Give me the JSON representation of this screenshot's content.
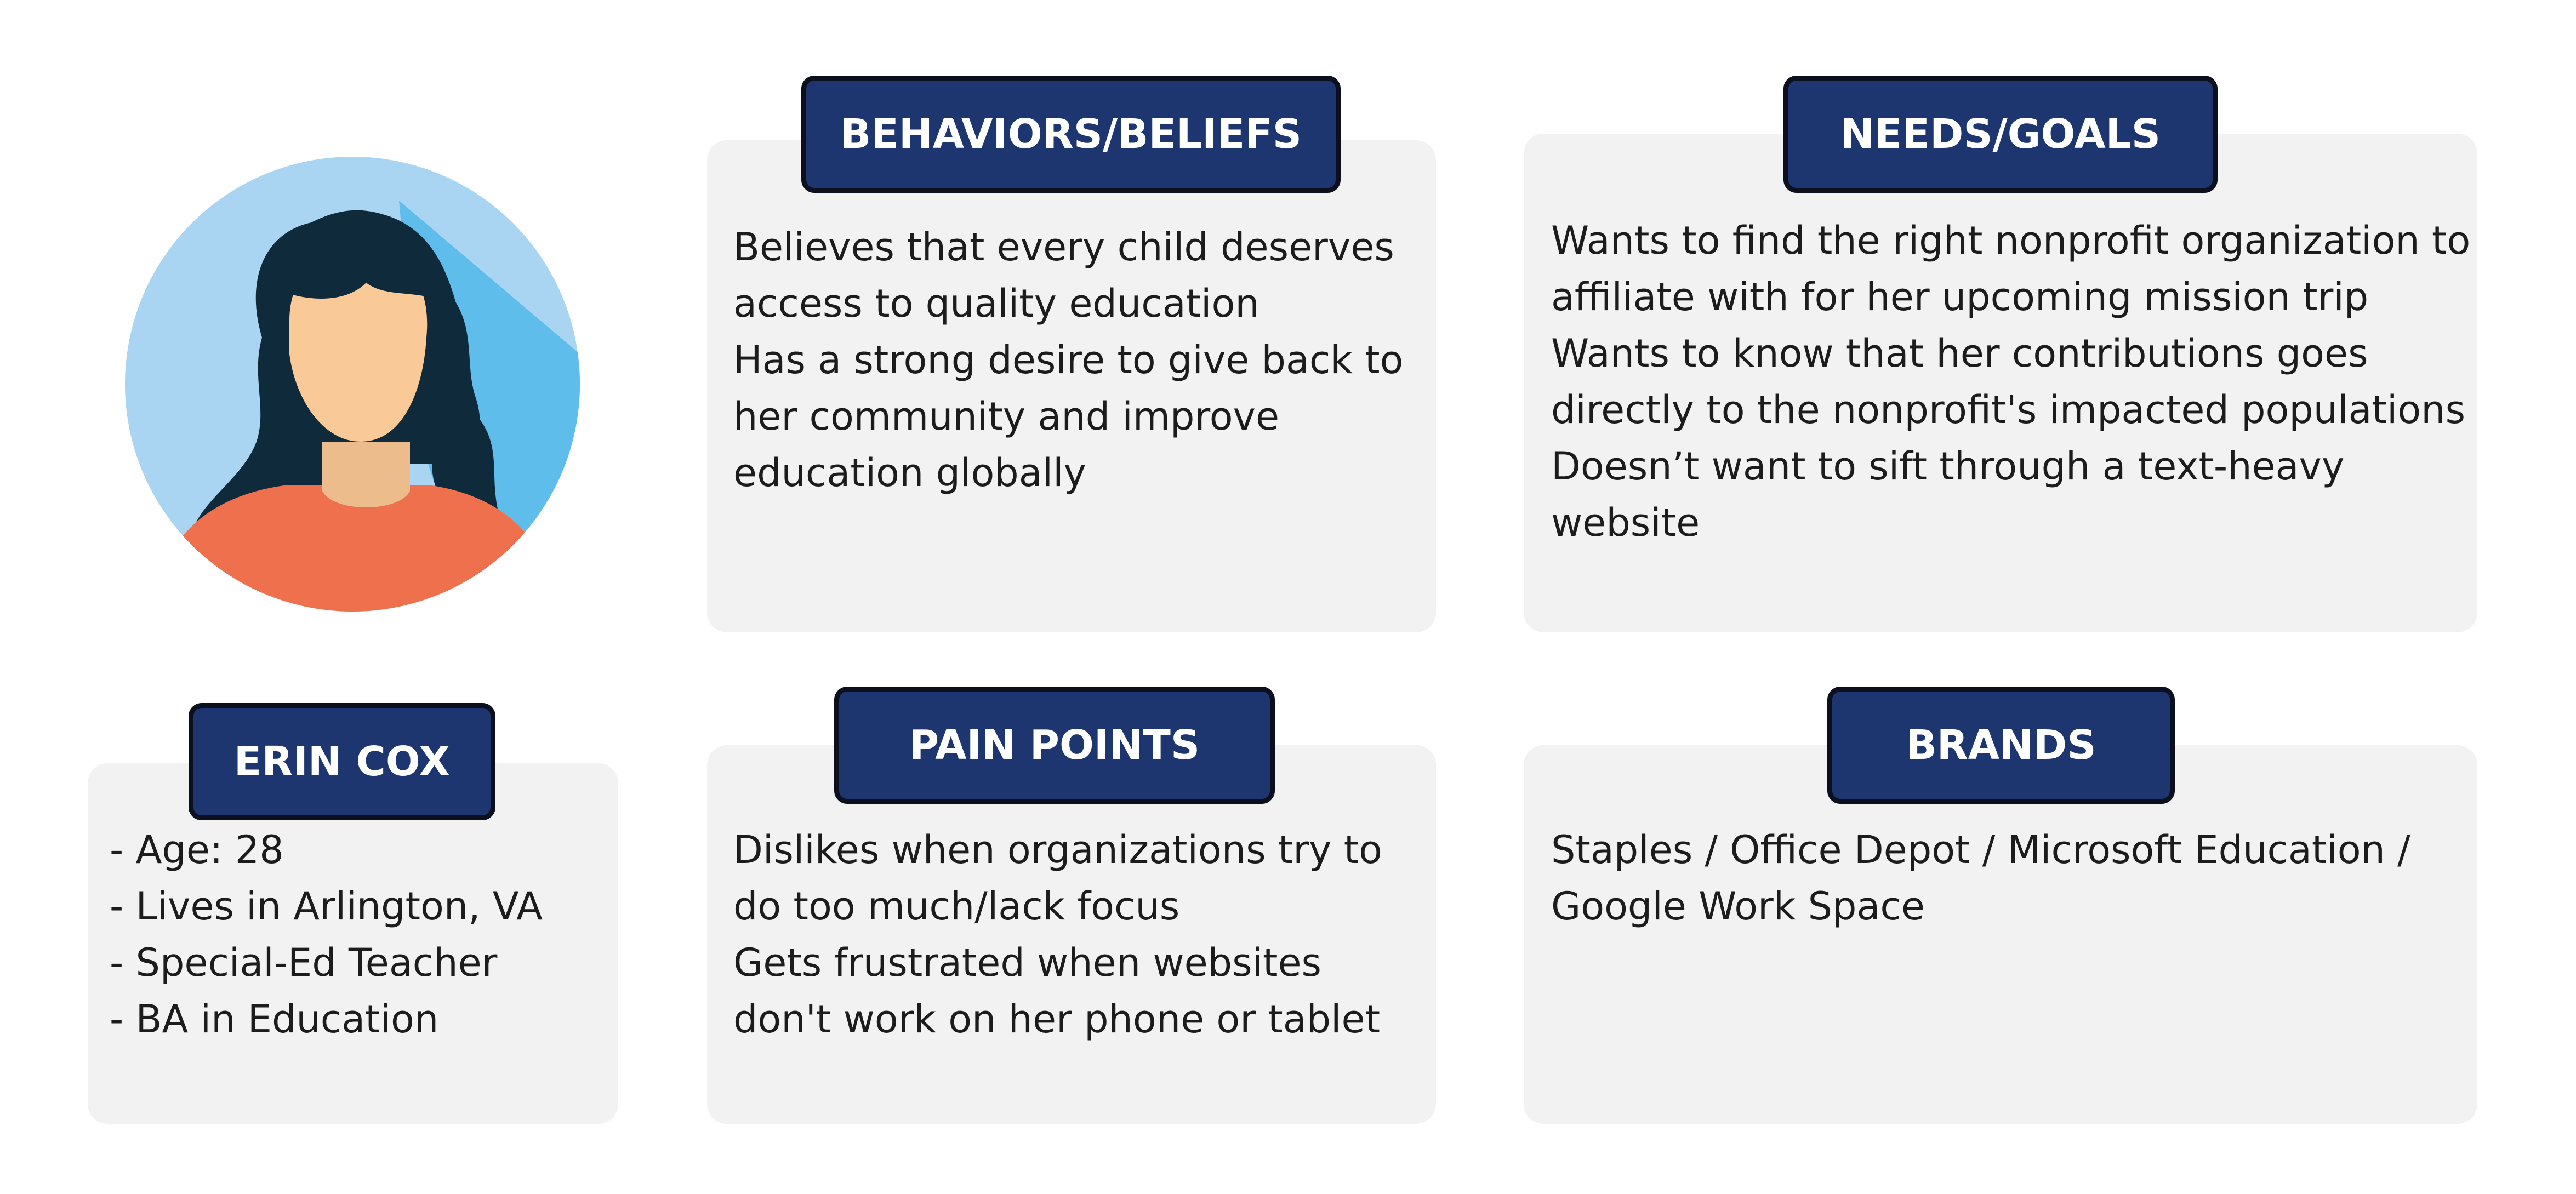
{
  "persona": {
    "name": "ERIN COX",
    "details": [
      "- Age: 28",
      "- Lives in Arlington, VA",
      "- Special-Ed Teacher",
      "- BA in Education"
    ]
  },
  "behaviors": {
    "title": "BEHAVIORS/BELIEFS",
    "lines": [
      "Believes that every child deserves",
      "access to quality education",
      "Has a strong desire to give back to",
      "her community and improve",
      "education globally"
    ]
  },
  "needs": {
    "title": "NEEDS/GOALS",
    "lines": [
      "Wants to find the right nonprofit organization to",
      "affiliate with for her upcoming mission trip",
      "Wants to know that her contributions goes",
      "directly to the nonprofit's impacted populations",
      "Doesn’t want to sift through a text-heavy",
      "website"
    ]
  },
  "pain_points": {
    "title": "PAIN POINTS",
    "lines": [
      "Dislikes when organizations try to",
      "do too much/lack focus",
      "Gets frustrated when websites",
      "don't work on her phone or tablet"
    ]
  },
  "brands": {
    "title": "BRANDS",
    "lines": [
      "Staples / Office Depot / Microsoft Education /",
      "Google Work Space"
    ]
  },
  "colors": {
    "tag_background": "#1e3670",
    "tag_border": "#0b0f1e",
    "card_background": "#f2f2f2",
    "avatar_bg_light": "#a9d5f2",
    "avatar_bg_shade": "#5fbdec",
    "hair": "#0e2a3b",
    "skin": "#f9c998",
    "shirt": "#ee704c"
  },
  "icons": {
    "avatar": "woman-avatar-icon"
  }
}
